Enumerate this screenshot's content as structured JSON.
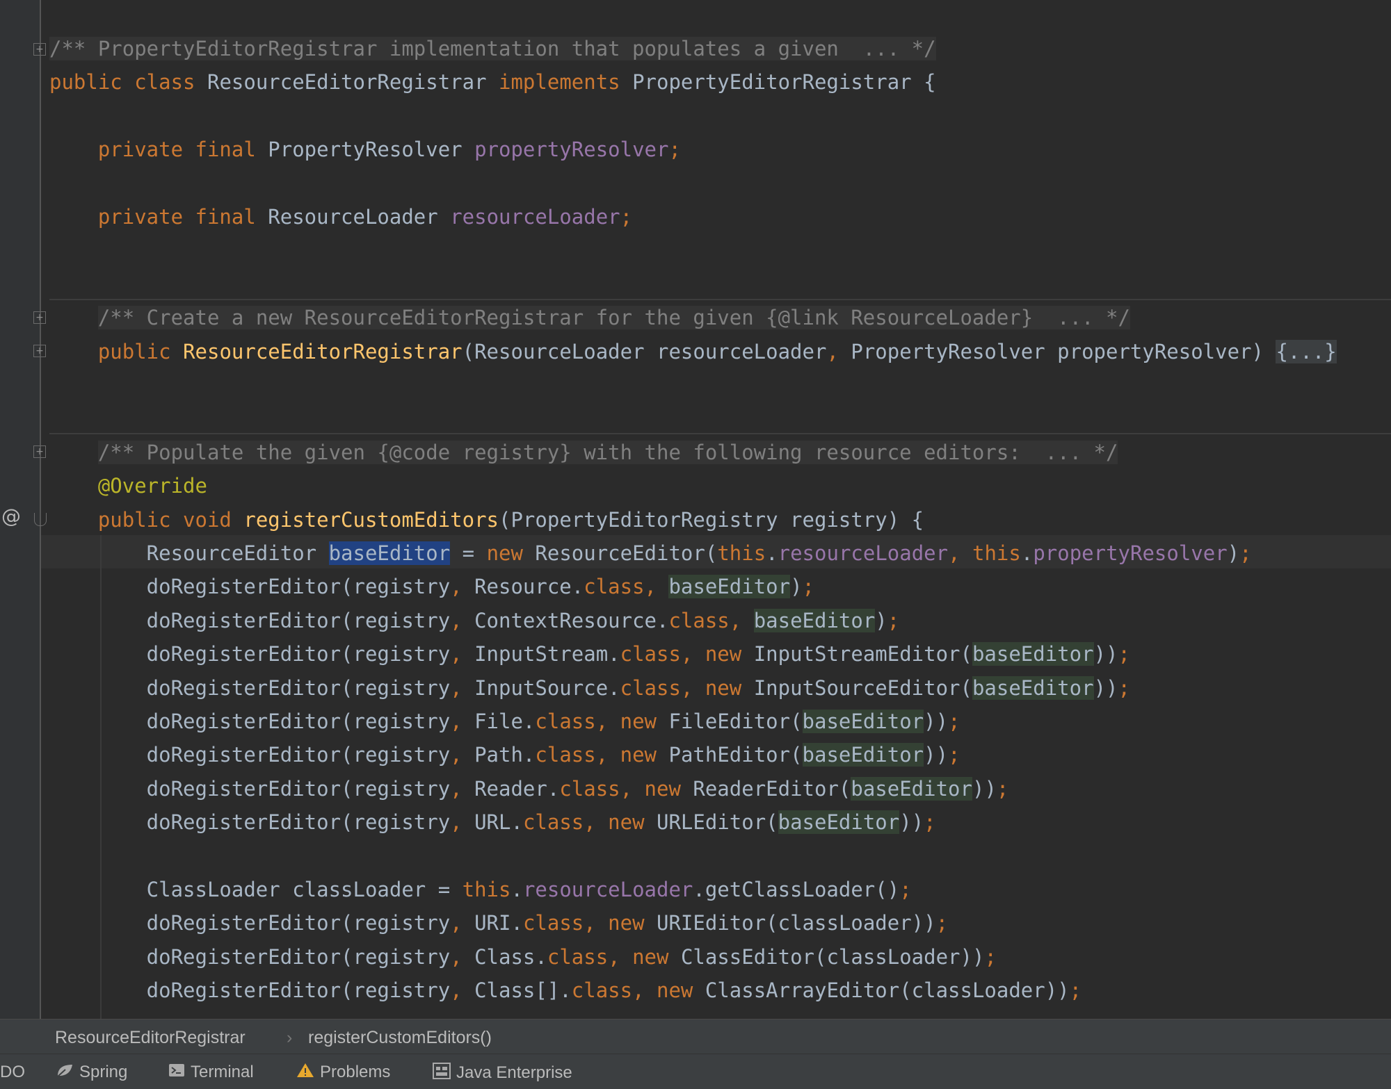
{
  "editor": {
    "lines": [
      {
        "tokens": [
          {
            "t": "/** PropertyEditorRegistrar implementation that populates a given  ... */",
            "c": "cm"
          }
        ]
      },
      {
        "tokens": [
          {
            "t": "public class ",
            "c": "k"
          },
          {
            "t": "ResourceEditorRegistrar "
          },
          {
            "t": "implements ",
            "c": "k"
          },
          {
            "t": "PropertyEditorRegistrar {"
          }
        ]
      },
      {
        "tokens": []
      },
      {
        "tokens": [
          {
            "t": "    private final ",
            "c": "k"
          },
          {
            "t": "PropertyResolver "
          },
          {
            "t": "propertyResolver",
            "c": "f"
          },
          {
            "t": ";",
            "c": "k"
          }
        ]
      },
      {
        "tokens": []
      },
      {
        "tokens": [
          {
            "t": "    private final ",
            "c": "k"
          },
          {
            "t": "ResourceLoader "
          },
          {
            "t": "resourceLoader",
            "c": "f"
          },
          {
            "t": ";",
            "c": "k"
          }
        ]
      },
      {
        "tokens": []
      },
      {
        "tokens": []
      },
      {
        "tokens": [
          {
            "t": "    "
          },
          {
            "t": "/** Create a new ResourceEditorRegistrar for the given {@link ResourceLoader}  ... */",
            "c": "cm"
          }
        ]
      },
      {
        "tokens": [
          {
            "t": "    public ",
            "c": "k"
          },
          {
            "t": "ResourceEditorRegistrar",
            "c": "m"
          },
          {
            "t": "(ResourceLoader resourceLoader"
          },
          {
            "t": ", ",
            "c": "k"
          },
          {
            "t": "PropertyResolver propertyResolver) "
          },
          {
            "t": "{...}",
            "c": "fp"
          }
        ]
      },
      {
        "tokens": []
      },
      {
        "tokens": []
      },
      {
        "tokens": [
          {
            "t": "    "
          },
          {
            "t": "/** Populate the given {@code registry} with the following resource editors:  ... */",
            "c": "cm"
          }
        ]
      },
      {
        "tokens": [
          {
            "t": "    "
          },
          {
            "t": "@Override",
            "c": "a"
          }
        ]
      },
      {
        "tokens": [
          {
            "t": "    public void ",
            "c": "k"
          },
          {
            "t": "registerCustomEditors",
            "c": "m"
          },
          {
            "t": "(PropertyEditorRegistry registry) {"
          }
        ]
      },
      {
        "tokens": [
          {
            "t": "        ResourceEditor "
          },
          {
            "t": "baseEditor",
            "c": "sel"
          },
          {
            "t": " = "
          },
          {
            "t": "new ",
            "c": "k"
          },
          {
            "t": "ResourceEditor("
          },
          {
            "t": "this",
            "c": "k"
          },
          {
            "t": "."
          },
          {
            "t": "resourceLoader",
            "c": "f"
          },
          {
            "t": ", ",
            "c": "k"
          },
          {
            "t": "this",
            "c": "k"
          },
          {
            "t": "."
          },
          {
            "t": "propertyResolver",
            "c": "f"
          },
          {
            "t": ")"
          },
          {
            "t": ";",
            "c": "k"
          }
        ]
      },
      {
        "tokens": [
          {
            "t": "        doRegisterEditor(registry"
          },
          {
            "t": ", ",
            "c": "k"
          },
          {
            "t": "Resource."
          },
          {
            "t": "class",
            "c": "k"
          },
          {
            "t": ", ",
            "c": "k"
          },
          {
            "t": "baseEditor",
            "c": "hl"
          },
          {
            "t": ")"
          },
          {
            "t": ";",
            "c": "k"
          }
        ]
      },
      {
        "tokens": [
          {
            "t": "        doRegisterEditor(registry"
          },
          {
            "t": ", ",
            "c": "k"
          },
          {
            "t": "ContextResource."
          },
          {
            "t": "class",
            "c": "k"
          },
          {
            "t": ", ",
            "c": "k"
          },
          {
            "t": "baseEditor",
            "c": "hl"
          },
          {
            "t": ")"
          },
          {
            "t": ";",
            "c": "k"
          }
        ]
      },
      {
        "tokens": [
          {
            "t": "        doRegisterEditor(registry"
          },
          {
            "t": ", ",
            "c": "k"
          },
          {
            "t": "InputStream."
          },
          {
            "t": "class",
            "c": "k"
          },
          {
            "t": ", ",
            "c": "k"
          },
          {
            "t": "new ",
            "c": "k"
          },
          {
            "t": "InputStreamEditor("
          },
          {
            "t": "baseEditor",
            "c": "hl"
          },
          {
            "t": "))"
          },
          {
            "t": ";",
            "c": "k"
          }
        ]
      },
      {
        "tokens": [
          {
            "t": "        doRegisterEditor(registry"
          },
          {
            "t": ", ",
            "c": "k"
          },
          {
            "t": "InputSource."
          },
          {
            "t": "class",
            "c": "k"
          },
          {
            "t": ", ",
            "c": "k"
          },
          {
            "t": "new ",
            "c": "k"
          },
          {
            "t": "InputSourceEditor("
          },
          {
            "t": "baseEditor",
            "c": "hl"
          },
          {
            "t": "))"
          },
          {
            "t": ";",
            "c": "k"
          }
        ]
      },
      {
        "tokens": [
          {
            "t": "        doRegisterEditor(registry"
          },
          {
            "t": ", ",
            "c": "k"
          },
          {
            "t": "File."
          },
          {
            "t": "class",
            "c": "k"
          },
          {
            "t": ", ",
            "c": "k"
          },
          {
            "t": "new ",
            "c": "k"
          },
          {
            "t": "FileEditor("
          },
          {
            "t": "baseEditor",
            "c": "hl"
          },
          {
            "t": "))"
          },
          {
            "t": ";",
            "c": "k"
          }
        ]
      },
      {
        "tokens": [
          {
            "t": "        doRegisterEditor(registry"
          },
          {
            "t": ", ",
            "c": "k"
          },
          {
            "t": "Path."
          },
          {
            "t": "class",
            "c": "k"
          },
          {
            "t": ", ",
            "c": "k"
          },
          {
            "t": "new ",
            "c": "k"
          },
          {
            "t": "PathEditor("
          },
          {
            "t": "baseEditor",
            "c": "hl"
          },
          {
            "t": "))"
          },
          {
            "t": ";",
            "c": "k"
          }
        ]
      },
      {
        "tokens": [
          {
            "t": "        doRegisterEditor(registry"
          },
          {
            "t": ", ",
            "c": "k"
          },
          {
            "t": "Reader."
          },
          {
            "t": "class",
            "c": "k"
          },
          {
            "t": ", ",
            "c": "k"
          },
          {
            "t": "new ",
            "c": "k"
          },
          {
            "t": "ReaderEditor("
          },
          {
            "t": "baseEditor",
            "c": "hl"
          },
          {
            "t": "))"
          },
          {
            "t": ";",
            "c": "k"
          }
        ]
      },
      {
        "tokens": [
          {
            "t": "        doRegisterEditor(registry"
          },
          {
            "t": ", ",
            "c": "k"
          },
          {
            "t": "URL."
          },
          {
            "t": "class",
            "c": "k"
          },
          {
            "t": ", ",
            "c": "k"
          },
          {
            "t": "new ",
            "c": "k"
          },
          {
            "t": "URLEditor("
          },
          {
            "t": "baseEditor",
            "c": "hl"
          },
          {
            "t": "))"
          },
          {
            "t": ";",
            "c": "k"
          }
        ]
      },
      {
        "tokens": []
      },
      {
        "tokens": [
          {
            "t": "        ClassLoader classLoader = "
          },
          {
            "t": "this",
            "c": "k"
          },
          {
            "t": "."
          },
          {
            "t": "resourceLoader",
            "c": "f"
          },
          {
            "t": ".getClassLoader()"
          },
          {
            "t": ";",
            "c": "k"
          }
        ]
      },
      {
        "tokens": [
          {
            "t": "        doRegisterEditor(registry"
          },
          {
            "t": ", ",
            "c": "k"
          },
          {
            "t": "URI."
          },
          {
            "t": "class",
            "c": "k"
          },
          {
            "t": ", ",
            "c": "k"
          },
          {
            "t": "new ",
            "c": "k"
          },
          {
            "t": "URIEditor(classLoader))"
          },
          {
            "t": ";",
            "c": "k"
          }
        ]
      },
      {
        "tokens": [
          {
            "t": "        doRegisterEditor(registry"
          },
          {
            "t": ", ",
            "c": "k"
          },
          {
            "t": "Class."
          },
          {
            "t": "class",
            "c": "k"
          },
          {
            "t": ", ",
            "c": "k"
          },
          {
            "t": "new ",
            "c": "k"
          },
          {
            "t": "ClassEditor(classLoader))"
          },
          {
            "t": ";",
            "c": "k"
          }
        ]
      },
      {
        "tokens": [
          {
            "t": "        doRegisterEditor(registry"
          },
          {
            "t": ", ",
            "c": "k"
          },
          {
            "t": "Class[]."
          },
          {
            "t": "class",
            "c": "k"
          },
          {
            "t": ", ",
            "c": "k"
          },
          {
            "t": "new ",
            "c": "k"
          },
          {
            "t": "ClassArrayEditor(classLoader))"
          },
          {
            "t": ";",
            "c": "k"
          }
        ]
      }
    ]
  },
  "gutter": {
    "override_marker": "@"
  },
  "breadcrumb": {
    "class_name": "ResourceEditorRegistrar",
    "separator": "›",
    "method_name": "registerCustomEditors()"
  },
  "tool_windows": [
    {
      "label": "DO",
      "icon": "todo-icon"
    },
    {
      "label": "Spring",
      "icon": "spring-leaf-icon"
    },
    {
      "label": "Terminal",
      "icon": "terminal-icon"
    },
    {
      "label": "Problems",
      "icon": "warning-icon"
    },
    {
      "label": "Java Enterprise",
      "icon": "java-enterprise-icon"
    }
  ],
  "colors": {
    "background": "#2b2b2b",
    "keyword": "#cc7832",
    "field": "#9876aa",
    "method_decl": "#ffc66d",
    "annotation": "#bbb529",
    "comment": "#808080",
    "text": "#a9b7c6",
    "selection": "#214283",
    "usage_highlight": "#344134"
  }
}
